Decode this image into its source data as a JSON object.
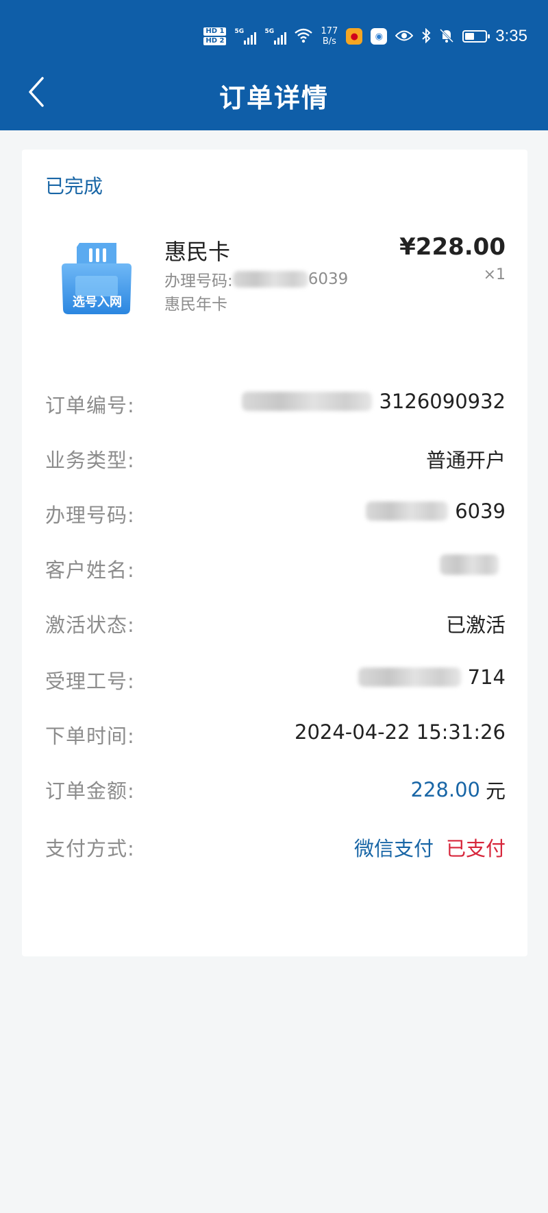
{
  "status_bar": {
    "hd1": "HD 1",
    "hd2": "HD 2",
    "sim1": "5G",
    "sim2": "5G",
    "speed_value": "177",
    "speed_unit": "B/s",
    "time": "3:35",
    "battery_level": 0.45,
    "icons": [
      "wifi-icon",
      "weibo-icon",
      "browser-icon",
      "eye-icon",
      "bluetooth-icon",
      "bell-off-icon",
      "battery-icon"
    ]
  },
  "header": {
    "title": "订单详情",
    "back_icon": "chevron-left-icon",
    "bg_color": "#0f5ea8"
  },
  "order": {
    "status": "已完成",
    "product": {
      "image_label": "选号入网",
      "name": "惠民卡",
      "number_label": "办理号码:",
      "number_tail": "6039",
      "plan": "惠民年卡",
      "price": "¥228.00",
      "quantity": "×1"
    },
    "details": [
      {
        "label": "订单编号:",
        "value": "3126090932"
      },
      {
        "label": "业务类型:",
        "value": "普通开户"
      },
      {
        "label": "办理号码:",
        "value": "6039"
      },
      {
        "label": "客户姓名:",
        "value": ""
      },
      {
        "label": "激活状态:",
        "value": "已激活"
      },
      {
        "label": "受理工号:",
        "value": "714"
      },
      {
        "label": "下单时间:",
        "value": "2024-04-22 15:31:26"
      },
      {
        "label": "订单金额:",
        "value": "228.00",
        "unit": "元"
      },
      {
        "label": "支付方式:",
        "value": "微信支付",
        "status": "已支付"
      }
    ]
  },
  "colors": {
    "accent_blue": "#1966a6",
    "paid_red": "#d7263b"
  }
}
